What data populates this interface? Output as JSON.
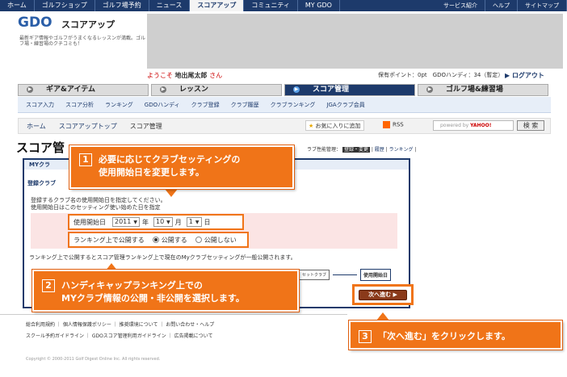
{
  "topnav": {
    "items": [
      "ホーム",
      "ゴルフショップ",
      "ゴルフ場予約",
      "ニュース",
      "スコアアップ",
      "コミュニティ",
      "MY GDO"
    ],
    "active": "スコアアップ",
    "right": [
      "サービス紹介",
      "ヘルプ",
      "サイトマップ"
    ]
  },
  "header": {
    "logo": "GDO",
    "logo_sub": "スコアアップ",
    "tagline": "最新ギア情報やゴルフがうまくなるレッスンが満載。ゴルフ場・練習場のクチコミも！",
    "welcome_prefix": "ようこそ",
    "user_name": "地出尾太郎",
    "user_suffix": "さん",
    "points": "保有ポイント：0pt　GDOハンディ：34（暫定）",
    "logout": "ログアウト"
  },
  "maintabs": [
    "ギア&アイテム",
    "レッスン",
    "スコア管理",
    "ゴルフ場&練習場"
  ],
  "subnav": [
    "スコア入力",
    "スコア分析",
    "ランキング",
    "GDOハンディ",
    "クラブ登録",
    "クラブ履歴",
    "クラブランキング",
    "JGAクラブ会員"
  ],
  "breadcrumb": {
    "items": [
      "ホーム",
      "スコアアップトップ",
      "スコア管理"
    ],
    "favorite": "お気に入りに追加",
    "rss": "RSS",
    "search_powered": "powered by",
    "search_brand": "YAHOO!",
    "search_button": "検 索"
  },
  "page": {
    "title": "スコア管",
    "right_links_prefix": "ラブ性能管理：",
    "right_links": [
      "登録・変更",
      "履歴",
      "ランキング"
    ],
    "panel_head": "MYクラ",
    "panel_sub": "登録クラブ",
    "desc_line1": "登録するクラブ名の使用開始日を指定してください。",
    "desc_line2": "使用開始日はこのセッティング使い始めた日を指定",
    "form": {
      "date_label": "使用開始日",
      "year": "2011",
      "year_unit": "年",
      "month": "10",
      "month_unit": "月",
      "day": "1",
      "day_unit": "日",
      "publish_label": "ランキング上で公開する",
      "option_public": "公開する",
      "option_private": "公開しない"
    },
    "notice": "ランキング上で公開するとスコア管理ランキング上で現在のMyクラブセッティングが一般公開されます。",
    "flow": [
      "セットクラブ",
      "使用開始日"
    ],
    "next_button": "次へ進む"
  },
  "callouts": {
    "c1_num": "1",
    "c1_line1": "必要に応じてクラブセッティングの",
    "c1_line2": "使用開始日を変更します。",
    "c2_num": "2",
    "c2_line1": "ハンディキャップランキング上での",
    "c2_line2": "MYクラブ情報の公開・非公開を選択します。",
    "c3_num": "3",
    "c3_text": "「次へ進む」をクリックします。"
  },
  "footer": {
    "links1": "総合利用規約 ｜ 個人情報保護ポリシー ｜ 推奨環境について ｜ お問い合わせ・ヘルプ",
    "links2": "スクール予約ガイドライン ｜ GDOスコア管理利用ガイドライン ｜ 広告掲載について",
    "copyright": "Copyright © 2000-2011 Golf Digest Online Inc. All rights reserved."
  },
  "colors": {
    "brand": "#1d3a6b",
    "callout": "#f07418",
    "highlight_bg": "#fbe4e4"
  }
}
